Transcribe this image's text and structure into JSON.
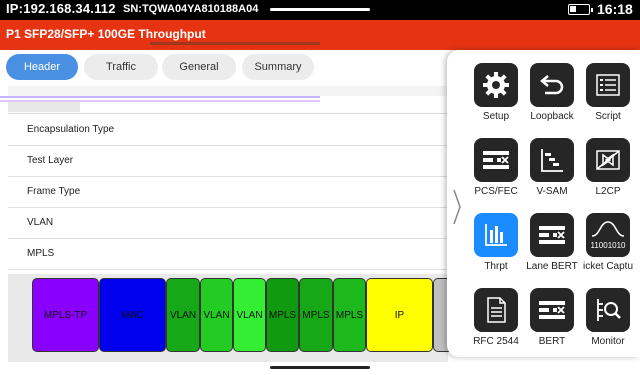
{
  "status_bar": {
    "ip": "IP:192.168.34.112",
    "sn": "SN:TQWA04YA810188A04",
    "time": "16:18"
  },
  "title_bar": {
    "title": "P1  SFP28/SFP+ 100GE Throughput"
  },
  "tabs": [
    {
      "label": "Header",
      "active": true
    },
    {
      "label": "Traffic",
      "active": false
    },
    {
      "label": "General",
      "active": false
    },
    {
      "label": "Summary",
      "active": false
    }
  ],
  "list": [
    {
      "label": "Encapsulation Type"
    },
    {
      "label": "Test Layer"
    },
    {
      "label": "Frame Type"
    },
    {
      "label": "VLAN"
    },
    {
      "label": "MPLS"
    }
  ],
  "protocol_blocks": [
    {
      "label": "MPLS-TP",
      "color": "#8a00ff"
    },
    {
      "label": "MAC",
      "color": "#0000ee"
    },
    {
      "label": "VLAN",
      "color": "#16a816"
    },
    {
      "label": "VLAN",
      "color": "#22cc22"
    },
    {
      "label": "VLAN",
      "color": "#33ee33"
    },
    {
      "label": "MPLS",
      "color": "#0f9a0f"
    },
    {
      "label": "MPLS",
      "color": "#16a816"
    },
    {
      "label": "MPLS",
      "color": "#1cb81c"
    },
    {
      "label": "IP",
      "color": "#ffff00"
    },
    {
      "label": "",
      "color": "#c0c0c0"
    }
  ],
  "apps": [
    {
      "label": "Setup",
      "icon": "gear-icon",
      "selected": false
    },
    {
      "label": "Loopback",
      "icon": "loopback-icon",
      "selected": false
    },
    {
      "label": "Script",
      "icon": "script-icon",
      "selected": false
    },
    {
      "label": "PCS/FEC",
      "icon": "pcs-fec-icon",
      "selected": false
    },
    {
      "label": "V-SAM",
      "icon": "vsam-icon",
      "selected": false
    },
    {
      "label": "L2CP",
      "icon": "l2cp-icon",
      "selected": false
    },
    {
      "label": "Thrpt",
      "icon": "throughput-icon",
      "selected": true
    },
    {
      "label": "Lane BERT",
      "icon": "lane-bert-icon",
      "selected": false
    },
    {
      "label": "icket Captu",
      "icon": "packet-capture-icon",
      "selected": false,
      "icon_text": "11001010"
    },
    {
      "label": "RFC 2544",
      "icon": "rfc2544-icon",
      "selected": false
    },
    {
      "label": "BERT",
      "icon": "bert-icon",
      "selected": false
    },
    {
      "label": "Monitor",
      "icon": "monitor-icon",
      "selected": false
    }
  ],
  "colors": {
    "title_bar": "#e63312",
    "active_tab": "#4a90e2",
    "selected_app": "#1a8cff"
  }
}
